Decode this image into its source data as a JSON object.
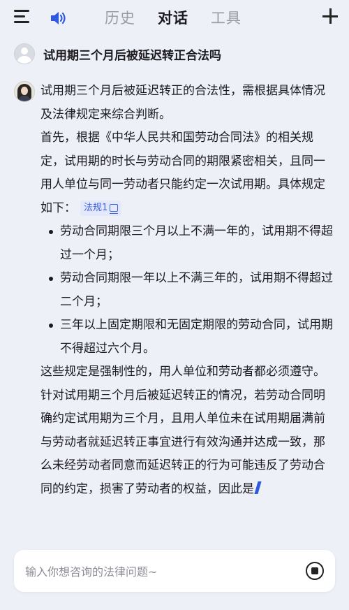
{
  "header": {
    "tabs": [
      {
        "label": "历史",
        "active": false
      },
      {
        "label": "对话",
        "active": true
      },
      {
        "label": "工具",
        "active": false
      }
    ],
    "icons": {
      "menu": "menu-icon",
      "speaker": "speaker-icon",
      "add": "plus-icon"
    },
    "accent_color": "#2f5ae0"
  },
  "chat": {
    "question": "试用期三个月后被延迟转正合法吗",
    "answer": {
      "intro": "试用期三个月后被延迟转正的合法性，需根据具体情况及法律规定来综合判断。",
      "para1": "首先，根据《中华人民共和国劳动合同法》的相关规定，试用期的时长与劳动合同的期限紧密相关，且同一用人单位与同一劳动者只能约定一次试用期。具体规定如下：",
      "citation": "法规1",
      "rules": [
        "劳动合同期限三个月以上不满一年的，试用期不得超过一个月；",
        "劳动合同期限一年以上不满三年的，试用期不得超过二个月；",
        "三年以上固定期限和无固定期限的劳动合同，试用期不得超过六个月。"
      ],
      "para2": "这些规定是强制性的，用人单位和劳动者都必须遵守。",
      "para3": "针对试用期三个月后被延迟转正的情况，若劳动合同明确约定试用期为三个月，且用人单位未在试用期届满前与劳动者就延迟转正事宜进行有效沟通并达成一致，那么未经劳动者同意而延迟转正的行为可能违反了劳动合同的约定，损害了劳动者的权益，因此是"
    }
  },
  "input": {
    "placeholder": "输入你想咨询的法律问题~",
    "value": ""
  }
}
